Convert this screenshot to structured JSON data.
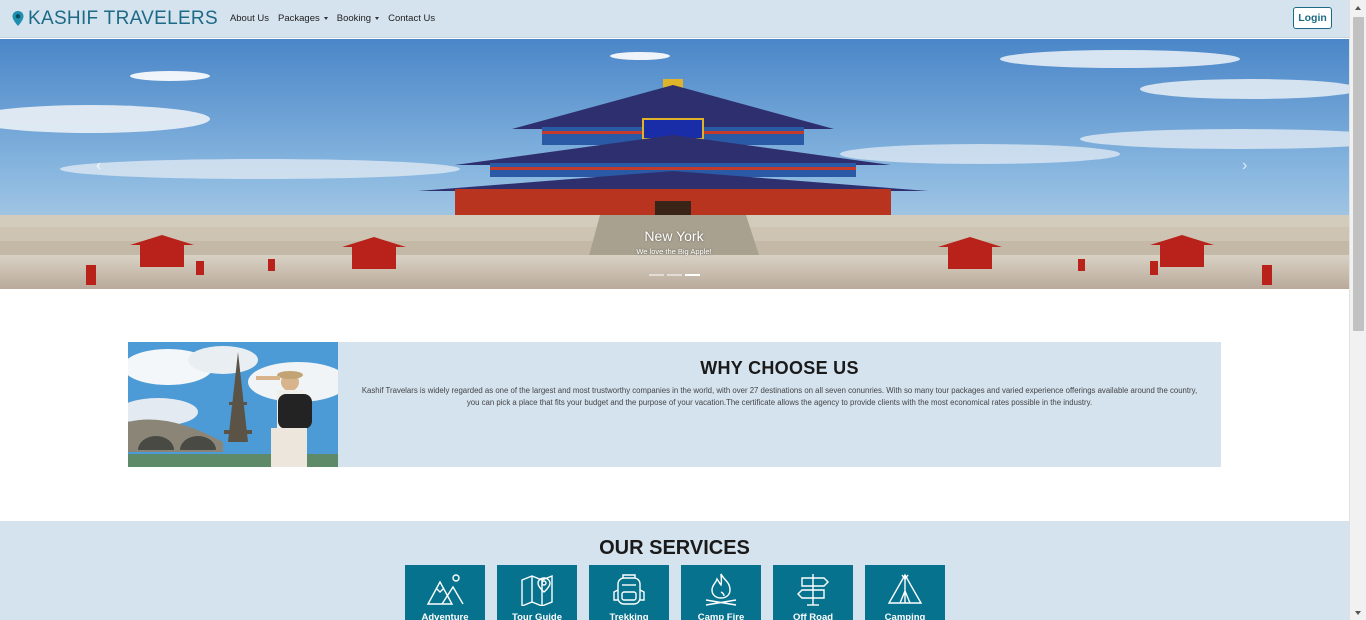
{
  "nav": {
    "brand": "KASHIF TRAVELERS",
    "links": [
      {
        "label": "About Us",
        "dropdown": false
      },
      {
        "label": "Packages",
        "dropdown": true
      },
      {
        "label": "Booking",
        "dropdown": true
      },
      {
        "label": "Contact Us",
        "dropdown": false
      }
    ],
    "login_label": "Login",
    "accent_color": "#1c6a86"
  },
  "carousel": {
    "caption_title": "New York",
    "caption_text": "We love the Big Apple!",
    "slides": 3,
    "active_index": 2,
    "prev_icon": "chevron-left-icon",
    "next_icon": "chevron-right-icon"
  },
  "why": {
    "title": "WHY CHOOSE US",
    "text": "Kashif Travelars is widely regarded as one of the largest and most trustworthy companies in the world, with over 27 destinations on all seven conunries. With so many tour packages and varied experience offerings available around the country, you can pick a place that fits your budget and the purpose of your vacation.The certificate allows the agency to provide clients with the most economical rates possible in the industry."
  },
  "services": {
    "title": "OUR SERVICES",
    "items": [
      {
        "label": "Adventure",
        "icon": "mountains-icon"
      },
      {
        "label": "Tour Guide",
        "icon": "map-pin-icon"
      },
      {
        "label": "Trekking",
        "icon": "backpack-icon"
      },
      {
        "label": "Camp Fire",
        "icon": "campfire-icon"
      },
      {
        "label": "Off Road",
        "icon": "signpost-icon"
      },
      {
        "label": "Camping",
        "icon": "tent-icon"
      }
    ],
    "tile_color": "#06728d"
  }
}
